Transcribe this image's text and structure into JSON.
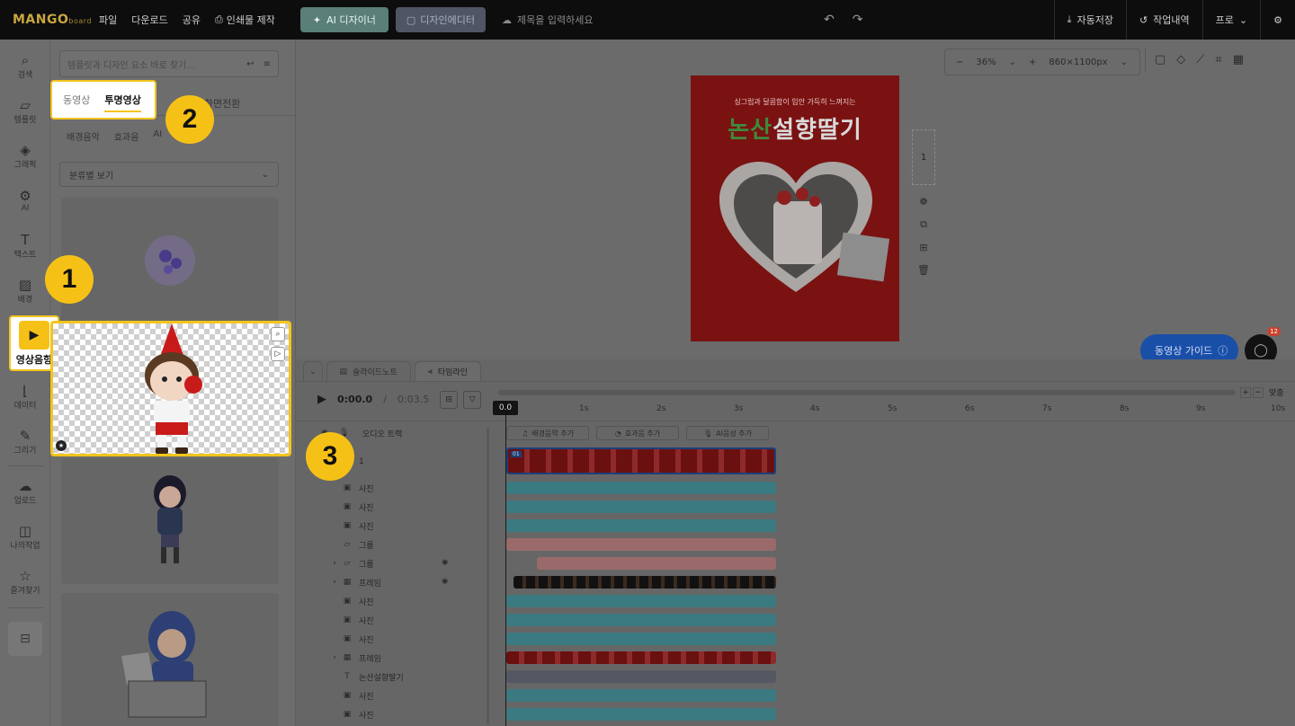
{
  "topbar": {
    "logo": "MANGO",
    "logo_sub": "board",
    "menu": [
      "파일",
      "다운로드",
      "공유",
      "인쇄물 제작"
    ],
    "ai_designer": "AI 디자이너",
    "design_editor": "디자인에디터",
    "title_placeholder": "제목을 입력하세요",
    "autosave": "자동저장",
    "history": "작업내역",
    "plan": "프로"
  },
  "rail": {
    "items": [
      {
        "label": "검색",
        "icon": "search-icon"
      },
      {
        "label": "템플릿",
        "icon": "template-icon"
      },
      {
        "label": "그래픽",
        "icon": "graphic-icon"
      },
      {
        "label": "AI",
        "icon": "ai-icon"
      },
      {
        "label": "텍스트",
        "icon": "text-icon"
      },
      {
        "label": "배경",
        "icon": "background-icon"
      },
      {
        "label": "데이터",
        "icon": "data-icon"
      },
      {
        "label": "그리기",
        "icon": "draw-icon"
      },
      {
        "label": "업로드",
        "icon": "upload-icon"
      },
      {
        "label": "나의작업",
        "icon": "my-work-icon"
      },
      {
        "label": "즐겨찾기",
        "icon": "favorite-icon"
      }
    ],
    "active_label": "영상음향"
  },
  "panel": {
    "search_placeholder": "템플릿과 디자인 요소 바로 찾기...",
    "tabs": [
      "동영상",
      "투명영상",
      "화면전환"
    ],
    "subtabs": [
      "배경음악",
      "효과음",
      "AI"
    ],
    "select_value": "분류별 보기"
  },
  "canvas": {
    "zoom": "36%",
    "size": "860×1100px",
    "poster_subtitle": "싱그럽과 달콤함이 입안 가득히 느껴지는",
    "poster_title_green": "논산",
    "poster_title_rest": "설향딸기",
    "page_number": "1",
    "guide_button": "동영상 가이드",
    "chat_badge": "12"
  },
  "timeline": {
    "tabs": [
      "슬라이드노트",
      "타임라인"
    ],
    "time_current": "0:00.0",
    "time_separator": "/",
    "time_total": "0:03.5",
    "fit_label": "맞춤",
    "playhead": "0.0",
    "ruler": [
      "1s",
      "2s",
      "3s",
      "4s",
      "5s",
      "6s",
      "7s",
      "8s",
      "9s",
      "10s"
    ],
    "audio_track": "오디오 트랙",
    "add_buttons": [
      "배경음악 추가",
      "효과음 추가",
      "AI음성 추가"
    ],
    "main_clip_tag": "01",
    "layers": [
      {
        "label": "1",
        "icon": "slide-icon",
        "chev": ""
      },
      {
        "label": "사진",
        "icon": "image-icon",
        "chev": ""
      },
      {
        "label": "사진",
        "icon": "image-icon",
        "chev": ""
      },
      {
        "label": "사진",
        "icon": "image-icon",
        "chev": ""
      },
      {
        "label": "그룹",
        "icon": "folder-icon",
        "chev": ""
      },
      {
        "label": "그룹",
        "icon": "folder-icon",
        "chev": "›"
      },
      {
        "label": "프레임",
        "icon": "frame-icon",
        "chev": "›"
      },
      {
        "label": "사진",
        "icon": "image-icon",
        "chev": ""
      },
      {
        "label": "사진",
        "icon": "image-icon",
        "chev": ""
      },
      {
        "label": "사진",
        "icon": "image-icon",
        "chev": ""
      },
      {
        "label": "프레임",
        "icon": "frame-icon",
        "chev": "›"
      },
      {
        "label": "논산설향딸기",
        "icon": "text-icon",
        "chev": ""
      },
      {
        "label": "사진",
        "icon": "image-icon",
        "chev": ""
      },
      {
        "label": "사진",
        "icon": "image-icon",
        "chev": ""
      }
    ]
  },
  "steps": [
    "1",
    "2",
    "3"
  ]
}
